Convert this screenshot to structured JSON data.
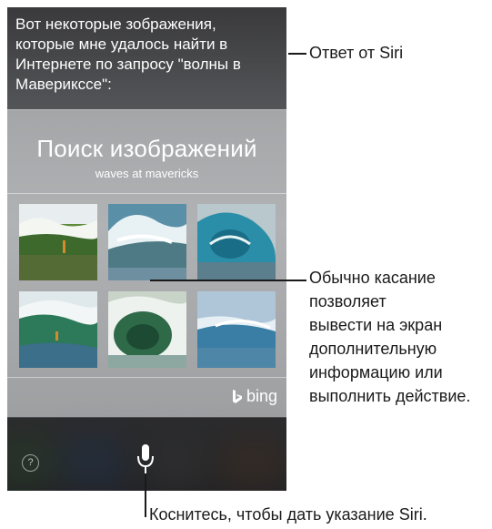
{
  "siri_answer": "Вот некоторые зображения, которые мне удалось найти в Интернете по запросу \"волны в Маверикссе\":",
  "card": {
    "title": "Поиск изображений",
    "subtitle": "waves at mavericks",
    "provider": "bing",
    "images": [
      {
        "name": "wave-image-1",
        "icon": "surf-wave-photo"
      },
      {
        "name": "wave-image-2",
        "icon": "surf-wave-photo"
      },
      {
        "name": "wave-image-3",
        "icon": "surf-wave-photo"
      },
      {
        "name": "wave-image-4",
        "icon": "surf-wave-photo"
      },
      {
        "name": "wave-image-5",
        "icon": "surf-wave-photo"
      },
      {
        "name": "wave-image-6",
        "icon": "surf-wave-photo"
      }
    ]
  },
  "bottom_bar": {
    "help_label": "?",
    "mic_icon": "microphone-icon"
  },
  "callouts": {
    "answer": "Ответ от Siri",
    "tap": [
      "Обычно касание",
      "позволяет",
      "вывести на экран",
      "дополнительную",
      "информацию или",
      "выполнить действие."
    ],
    "mic": "Коснитесь, чтобы дать указание Siri."
  }
}
